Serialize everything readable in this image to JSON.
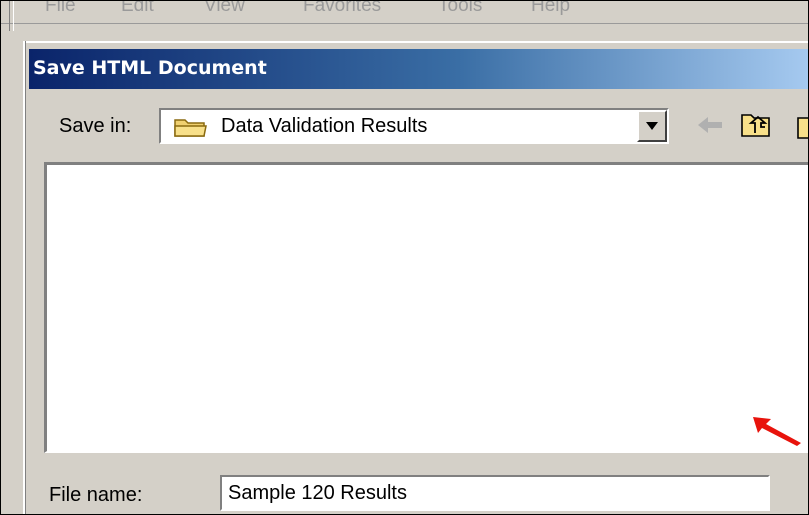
{
  "menubar": {
    "items": [
      "File",
      "Edit",
      "View",
      "Favorites",
      "Tools",
      "Help"
    ]
  },
  "dialog": {
    "title": "Save HTML Document",
    "save_in_label": "Save in:",
    "save_in_value": "Data Validation Results",
    "file_name_label": "File name:",
    "file_name_value": "Sample 120 Results"
  },
  "icons": {
    "folder": "folder-icon",
    "dropdown": "chevron-down-icon",
    "back": "back-arrow-icon",
    "up": "up-one-level-icon",
    "new_folder": "new-folder-icon",
    "annotation": "red-pointer-arrow-icon"
  },
  "colors": {
    "title_gradient_start": "#0a246a",
    "title_gradient_end": "#a6caf0",
    "dialog_face": "#d4d0c8",
    "annotation_arrow": "#e8130c"
  }
}
